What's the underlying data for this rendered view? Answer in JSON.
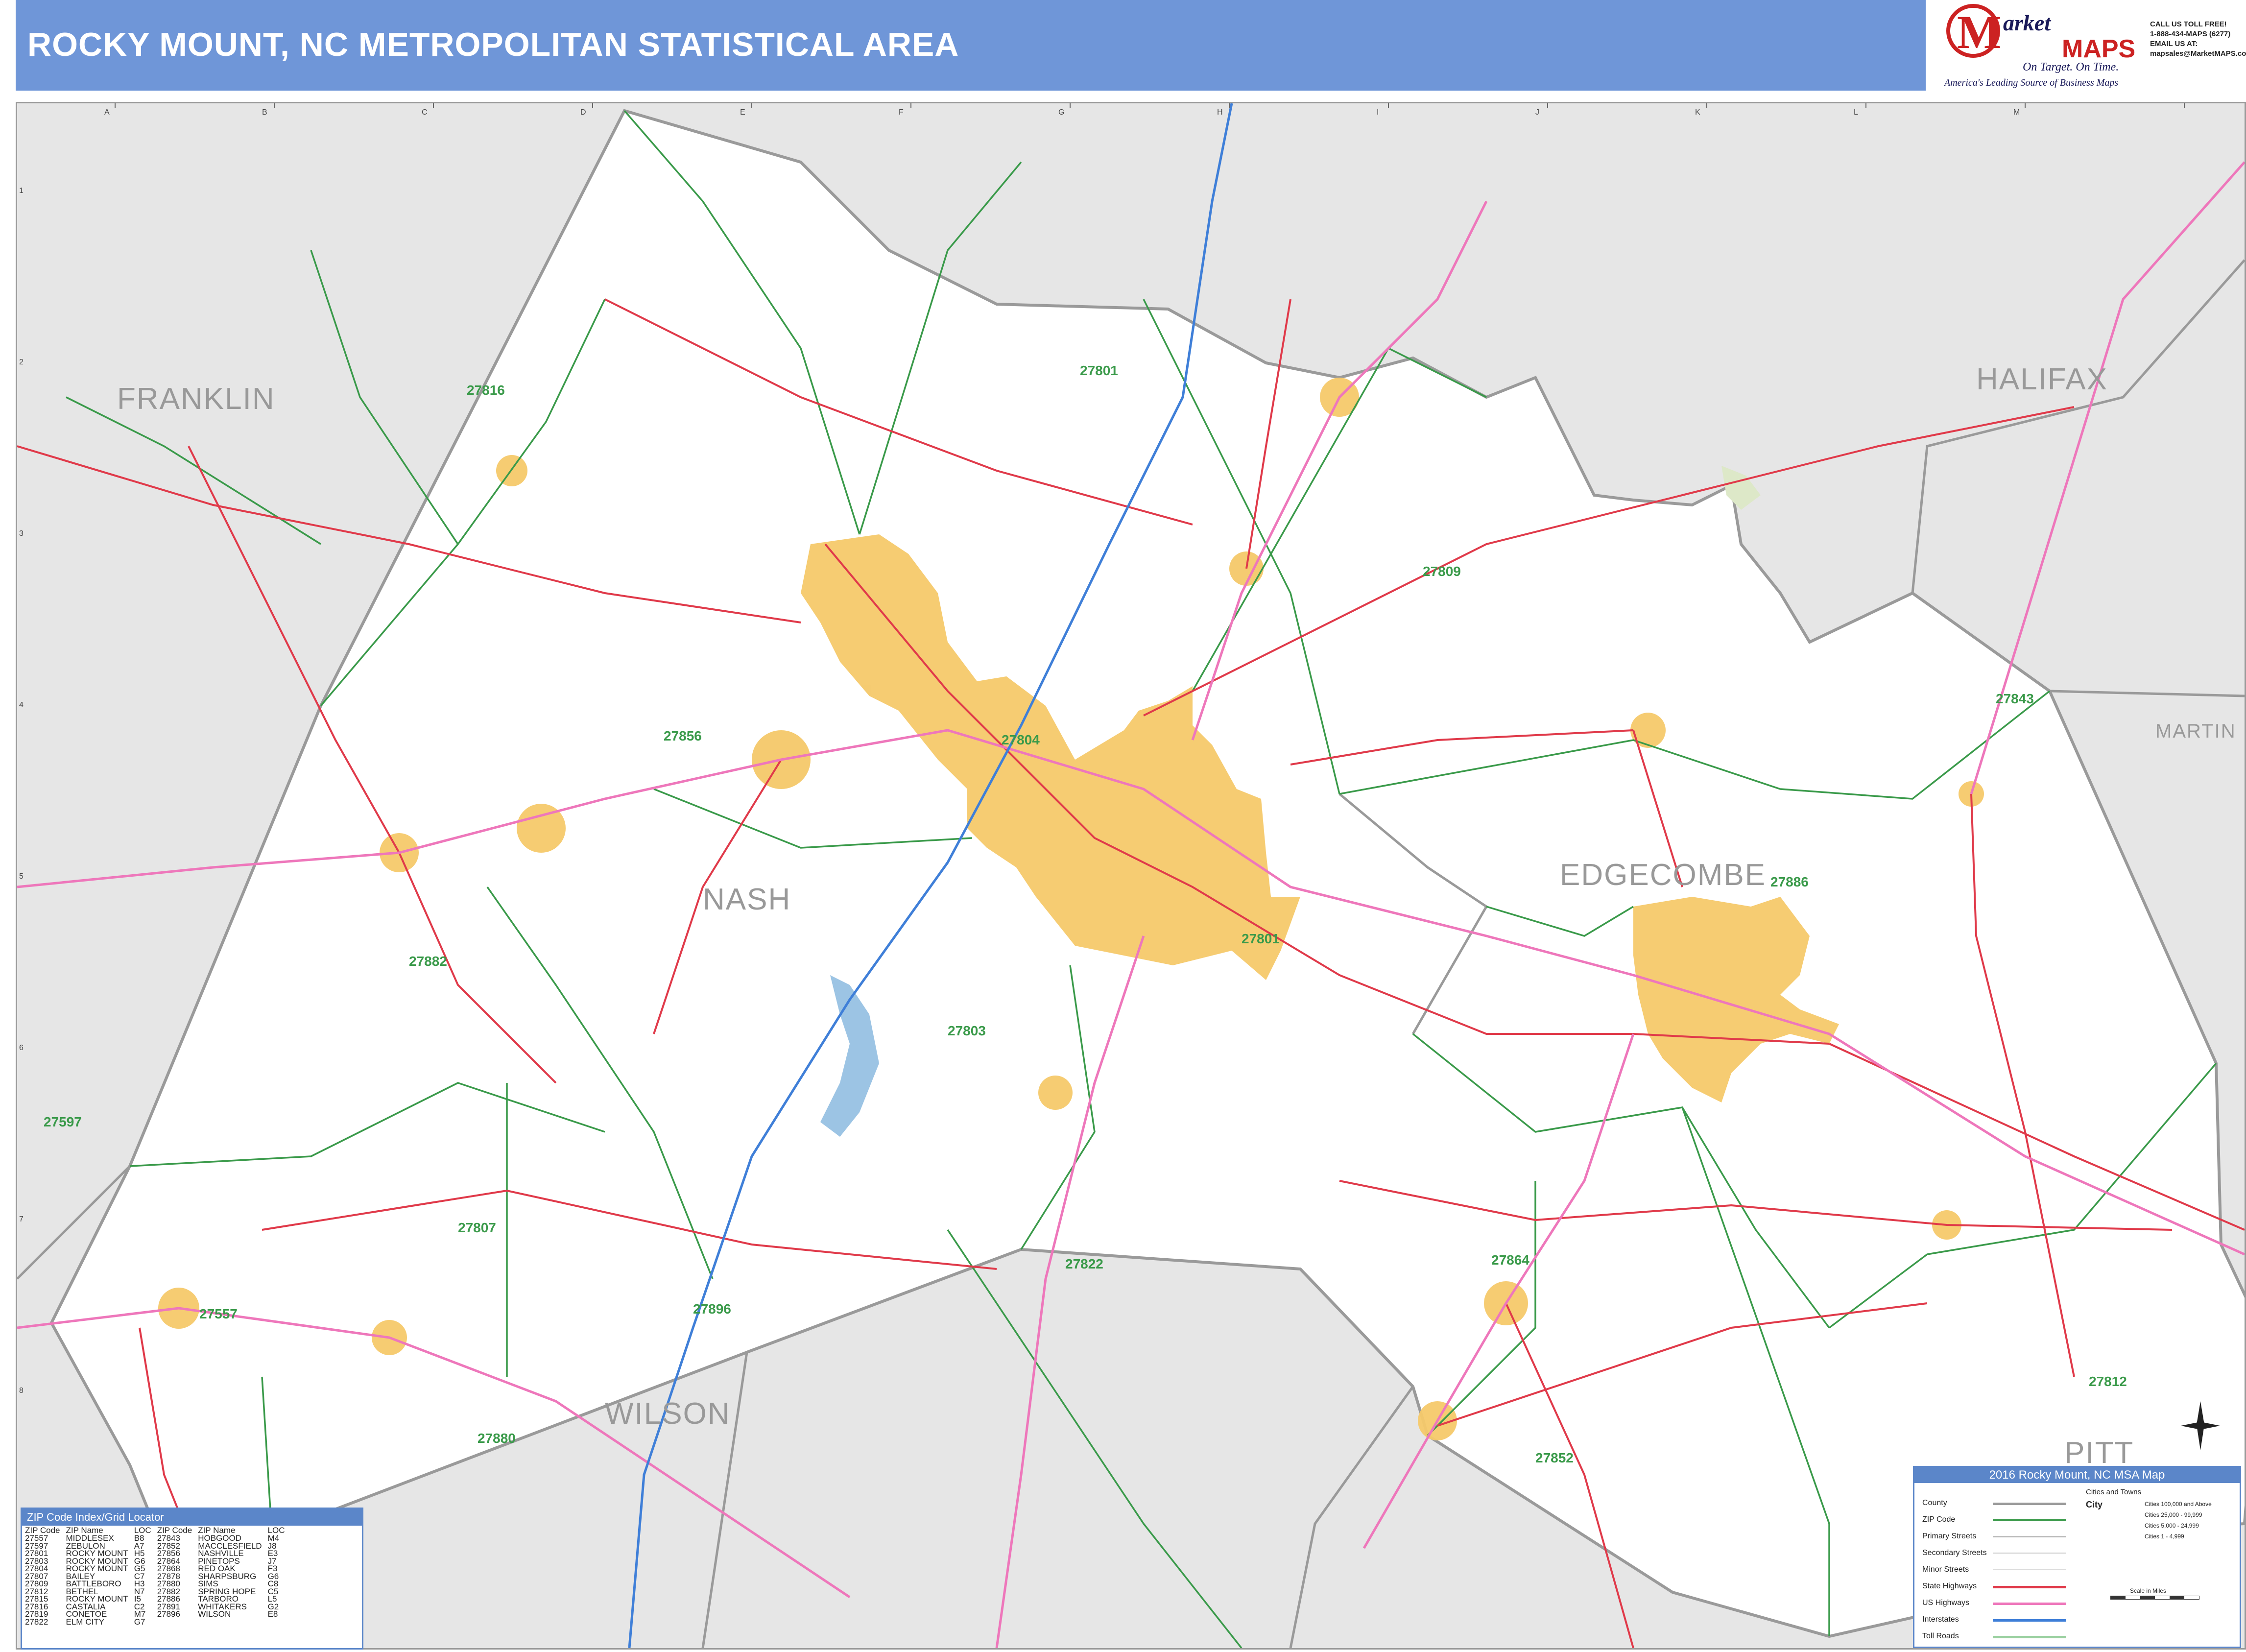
{
  "title": "ROCKY MOUNT, NC METROPOLITAN STATISTICAL AREA",
  "logo": {
    "name_part1": "arket",
    "name_part2": "MAPS",
    "tagline": "On Target. On Time.",
    "subtitle": "America's Leading Source of Business Maps"
  },
  "contact": {
    "line1": "CALL US TOLL FREE!",
    "line2": "1-888-434-MAPS (6277)",
    "line3": "EMAIL US AT:",
    "line4": "mapsales@MarketMAPS.com"
  },
  "grid": {
    "columns": [
      "A",
      "B",
      "C",
      "D",
      "E",
      "F",
      "G",
      "H",
      "I",
      "J",
      "K",
      "L",
      "M"
    ],
    "rows": [
      "1",
      "2",
      "3",
      "4",
      "5",
      "6",
      "7",
      "8"
    ]
  },
  "counties": {
    "franklin": "FRANKLIN",
    "halifax": "HALIFAX",
    "martin": "MARTIN",
    "nash": "NASH",
    "edgecombe": "EDGECOMBE",
    "wilson": "WILSON",
    "pitt": "PITT"
  },
  "zip_labels": [
    {
      "id": "z27816",
      "text": "27816"
    },
    {
      "id": "z27801a",
      "text": "27801"
    },
    {
      "id": "z27809",
      "text": "27809"
    },
    {
      "id": "z27856",
      "text": "27856"
    },
    {
      "id": "z27804",
      "text": "27804"
    },
    {
      "id": "z27843",
      "text": "27843"
    },
    {
      "id": "z27886",
      "text": "27886"
    },
    {
      "id": "z27882",
      "text": "27882"
    },
    {
      "id": "z27801b",
      "text": "27801"
    },
    {
      "id": "z27803",
      "text": "27803"
    },
    {
      "id": "z27597",
      "text": "27597"
    },
    {
      "id": "z27807",
      "text": "27807"
    },
    {
      "id": "z27822",
      "text": "27822"
    },
    {
      "id": "z27864",
      "text": "27864"
    },
    {
      "id": "z27557",
      "text": "27557"
    },
    {
      "id": "z27896",
      "text": "27896"
    },
    {
      "id": "z27880",
      "text": "27880"
    },
    {
      "id": "z27852",
      "text": "27852"
    },
    {
      "id": "z27812",
      "text": "27812"
    }
  ],
  "zip_index": {
    "title": "ZIP Code Index/Grid Locator",
    "headers": [
      "ZIP Code",
      "ZIP Name",
      "LOC",
      "ZIP Code",
      "ZIP Name",
      "LOC"
    ],
    "rows": [
      [
        "27557",
        "MIDDLESEX",
        "B8",
        "27843",
        "HOBGOOD",
        "M4"
      ],
      [
        "27597",
        "ZEBULON",
        "A7",
        "27852",
        "MACCLESFIELD",
        "J8"
      ],
      [
        "27801",
        "ROCKY MOUNT",
        "H5",
        "27856",
        "NASHVILLE",
        "E3"
      ],
      [
        "27803",
        "ROCKY MOUNT",
        "G6",
        "27864",
        "PINETOPS",
        "J7"
      ],
      [
        "27804",
        "ROCKY MOUNT",
        "G5",
        "27868",
        "RED OAK",
        "F3"
      ],
      [
        "27807",
        "BAILEY",
        "C7",
        "27878",
        "SHARPSBURG",
        "G6"
      ],
      [
        "27809",
        "BATTLEBORO",
        "H3",
        "27880",
        "SIMS",
        "C8"
      ],
      [
        "27812",
        "BETHEL",
        "N7",
        "27882",
        "SPRING HOPE",
        "C5"
      ],
      [
        "27815",
        "ROCKY MOUNT",
        "I5",
        "27886",
        "TARBORO",
        "L5"
      ],
      [
        "27816",
        "CASTALIA",
        "C2",
        "27891",
        "WHITAKERS",
        "G2"
      ],
      [
        "27819",
        "CONETOE",
        "M7",
        "27896",
        "WILSON",
        "E8"
      ],
      [
        "27822",
        "ELM CITY",
        "G7",
        "",
        "",
        ""
      ]
    ]
  },
  "legend": {
    "title": "2016 Rocky Mount, NC MSA Map",
    "cities_title": "Cities and Towns",
    "items": [
      "County",
      "ZIP Code",
      "Primary Streets",
      "Secondary Streets",
      "Minor Streets",
      "State Highways",
      "US Highways",
      "Interstates",
      "Toll Roads"
    ],
    "city_label": "City",
    "city_sizes": [
      "Cities 100,000 and Above",
      "Cities 25,000 - 99,999",
      "Cities 5,000 - 24,999",
      "Cities 1 - 4,999"
    ],
    "scale_label": "Scale in Miles"
  },
  "colors": {
    "title_bar": "#6f96d8",
    "county_line": "#9a9a9a",
    "zip_line": "#3a9a4a",
    "state_highway": "#e03a4a",
    "us_highway": "#ee77bb",
    "interstate": "#3f7fd8",
    "urban_area": "#f5c96a",
    "outside_area": "#e6e6e6"
  }
}
